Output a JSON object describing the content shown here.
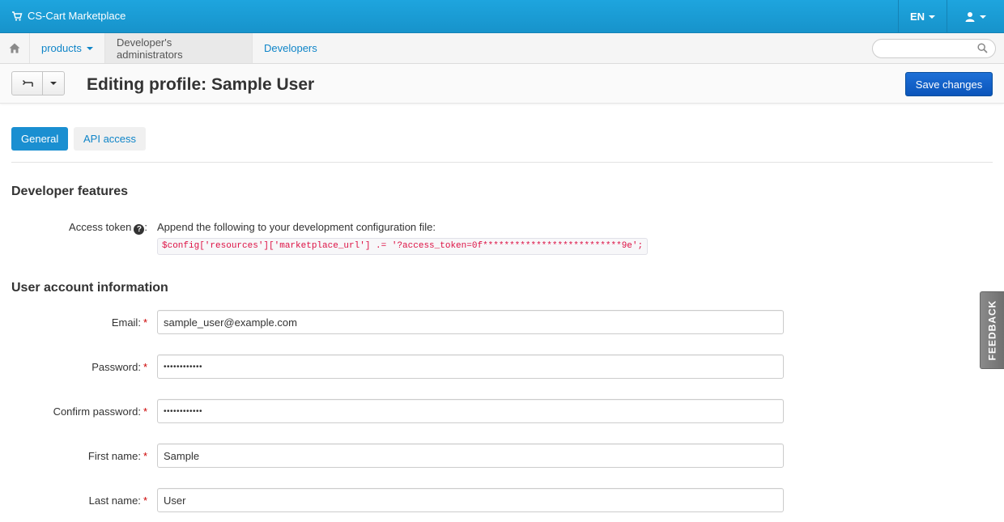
{
  "topbar": {
    "brand": "CS-Cart Marketplace",
    "language": "EN"
  },
  "nav": {
    "items": [
      {
        "label": "products"
      },
      {
        "label": "Developer's administrators"
      },
      {
        "label": "Developers"
      }
    ],
    "search_placeholder": ""
  },
  "header": {
    "title": "Editing profile: Sample User",
    "save_label": "Save changes"
  },
  "tabs": [
    {
      "label": "General",
      "active": true
    },
    {
      "label": "API access",
      "active": false
    }
  ],
  "developer_features": {
    "title": "Developer features",
    "access_token_label": "Access token",
    "instruction": "Append the following to your development configuration file:",
    "code": "$config['resources']['marketplace_url'] .= '?access_token=0f**************************9e';"
  },
  "account": {
    "title": "User account information",
    "fields": [
      {
        "label": "Email:",
        "value": "sample_user@example.com",
        "type": "text"
      },
      {
        "label": "Password:",
        "value": "••••••••••••",
        "type": "password"
      },
      {
        "label": "Confirm password:",
        "value": "••••••••••••",
        "type": "password"
      },
      {
        "label": "First name:",
        "value": "Sample",
        "type": "text"
      },
      {
        "label": "Last name:",
        "value": "User",
        "type": "text"
      }
    ]
  },
  "feedback": "FEEDBACK",
  "colors": {
    "topbar": "#1793cb",
    "link": "#0f85c8",
    "primary_button": "#0b55bb",
    "required": "#cc0000"
  }
}
